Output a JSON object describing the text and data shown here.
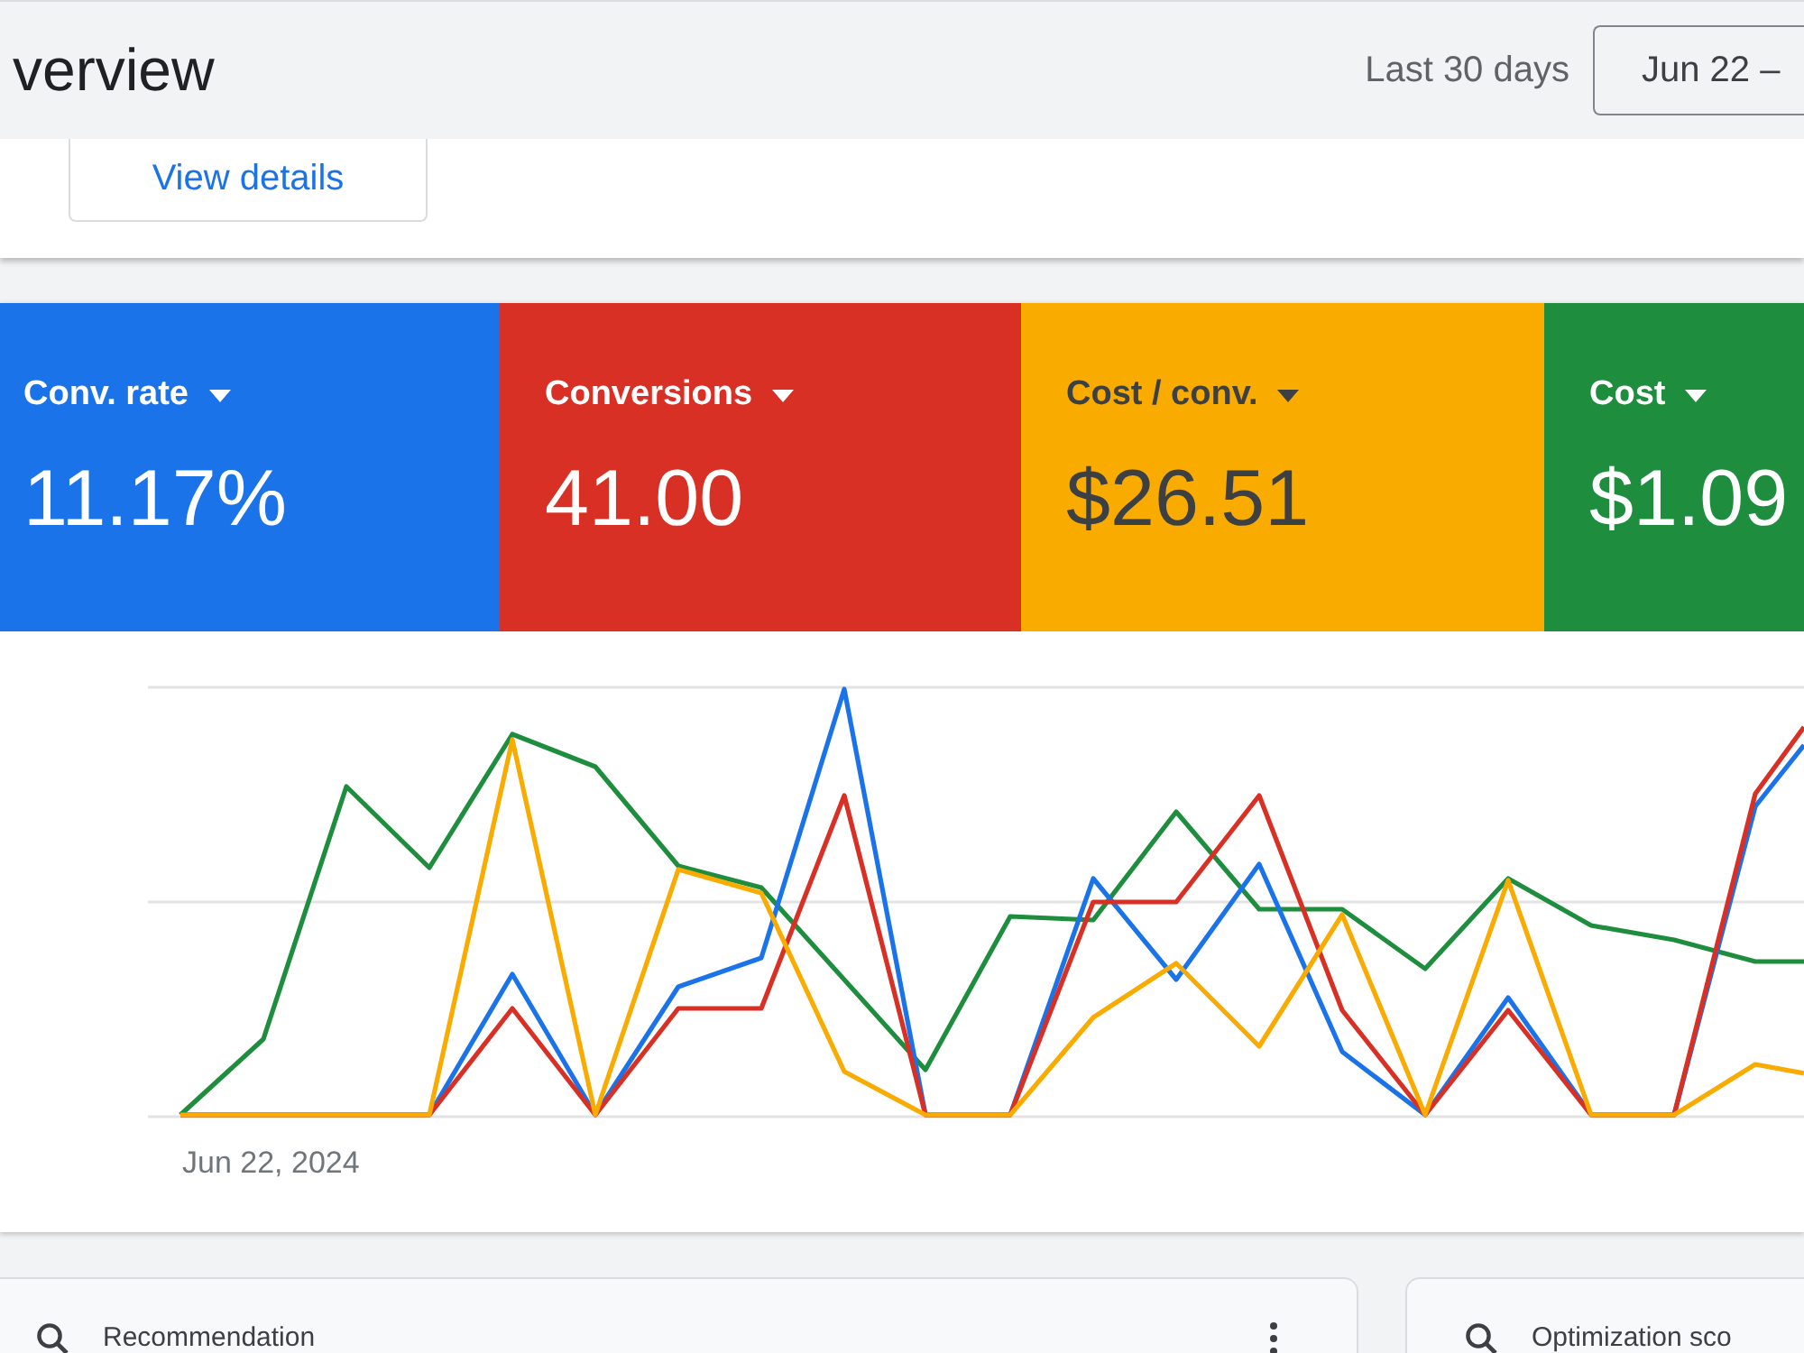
{
  "header": {
    "title": "verview",
    "range_label": "Last 30 days",
    "date_button": "Jun 22 –"
  },
  "summary_card": {
    "button": "View details"
  },
  "metrics": [
    {
      "label": "Conv. rate",
      "value": "11.17%",
      "color": "#1a73e8",
      "selected": true
    },
    {
      "label": "Conversions",
      "value": "41.00",
      "color": "#d93025",
      "selected": true
    },
    {
      "label": "Cost / conv.",
      "value": "$26.51",
      "color": "#f9ab00",
      "selected": true
    },
    {
      "label": "Cost",
      "value": "$1.09",
      "color": "#1e8e3e",
      "selected": true
    }
  ],
  "chart": {
    "x_label": "Jun 22, 2024"
  },
  "cards": [
    {
      "title": "Recommendation",
      "menu": true
    },
    {
      "title": "Optimization sco",
      "menu": false
    }
  ]
}
